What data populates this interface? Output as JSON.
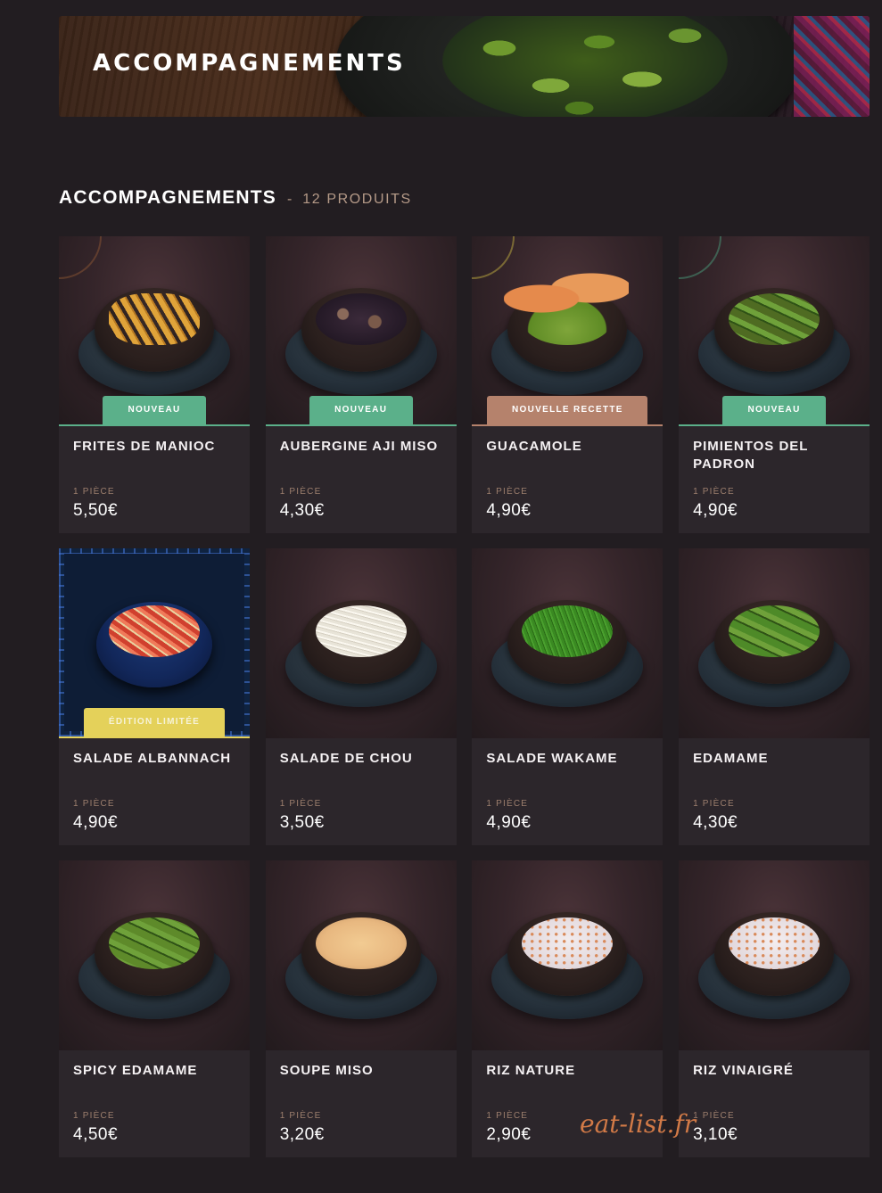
{
  "banner": {
    "title": "ACCOMPAGNEMENTS"
  },
  "section": {
    "title": "ACCOMPAGNEMENTS",
    "separator": "-",
    "count": "12 PRODUITS"
  },
  "products": [
    {
      "name": "FRITES DE MANIOC",
      "unit": "1 PIÈCE",
      "price": "5,50€",
      "badge": "NOUVEAU",
      "badge_type": "nouveau",
      "food_color": "#e0a43a",
      "food_icon": "fries-icon"
    },
    {
      "name": "AUBERGINE AJI MISO",
      "unit": "1 PIÈCE",
      "price": "4,30€",
      "badge": "NOUVEAU",
      "badge_type": "nouveau",
      "food_color": "#3b2a3a",
      "food_icon": "eggplant-icon"
    },
    {
      "name": "GUACAMOLE",
      "unit": "1 PIÈCE",
      "price": "4,90€",
      "badge": "NOUVELLE RECETTE",
      "badge_type": "recette",
      "food_color": "#7fa53a",
      "food_icon": "guacamole-icon"
    },
    {
      "name": "PIMIENTOS DEL PADRON",
      "unit": "1 PIÈCE",
      "price": "4,90€",
      "badge": "NOUVEAU",
      "badge_type": "nouveau",
      "food_color": "#4f6b22",
      "food_icon": "peppers-icon"
    },
    {
      "name": "SALADE ALBANNACH",
      "unit": "1 PIÈCE",
      "price": "4,90€",
      "badge": "ÉDITION LIMITÉE",
      "badge_type": "limitee",
      "food_color": "#d0402e",
      "food_icon": "salad-icon"
    },
    {
      "name": "SALADE DE CHOU",
      "unit": "1 PIÈCE",
      "price": "3,50€",
      "badge": "",
      "badge_type": "",
      "food_color": "#e8e4d8",
      "food_icon": "cabbage-icon"
    },
    {
      "name": "SALADE WAKAME",
      "unit": "1 PIÈCE",
      "price": "4,90€",
      "badge": "",
      "badge_type": "",
      "food_color": "#3a8a22",
      "food_icon": "seaweed-icon"
    },
    {
      "name": "EDAMAME",
      "unit": "1 PIÈCE",
      "price": "4,30€",
      "badge": "",
      "badge_type": "",
      "food_color": "#4e8a28",
      "food_icon": "edamame-icon"
    },
    {
      "name": "SPICY EDAMAME",
      "unit": "1 PIÈCE",
      "price": "4,50€",
      "badge": "",
      "badge_type": "",
      "food_color": "#5e8a2a",
      "food_icon": "spicy-edamame-icon"
    },
    {
      "name": "SOUPE MISO",
      "unit": "1 PIÈCE",
      "price": "3,20€",
      "badge": "",
      "badge_type": "",
      "food_color": "#e8b880",
      "food_icon": "soup-icon"
    },
    {
      "name": "RIZ NATURE",
      "unit": "1 PIÈCE",
      "price": "2,90€",
      "badge": "",
      "badge_type": "",
      "food_color": "#f2ecee",
      "food_icon": "rice-icon"
    },
    {
      "name": "RIZ VINAIGRÉ",
      "unit": "1 PIÈCE",
      "price": "3,10€",
      "badge": "",
      "badge_type": "",
      "food_color": "#f4eef0",
      "food_icon": "vinegar-rice-icon"
    }
  ],
  "watermark": "eat-list.fr"
}
